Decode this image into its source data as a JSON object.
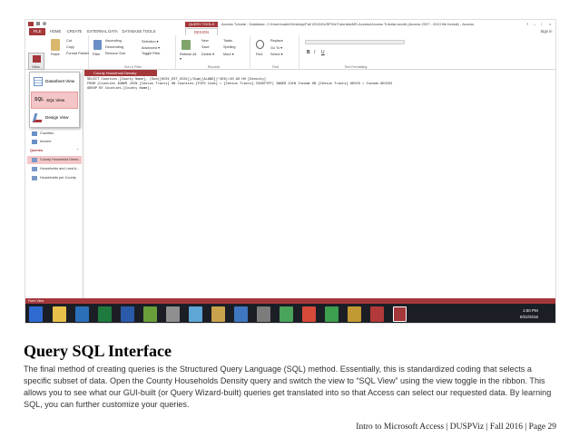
{
  "app": {
    "title_bar": "Access Tutorial : Database- C:\\Users\\ualm\\Desktop\\Fall 2016\\DUSPViz\\Tutorials\\MS-Access\\Access Tutorial.accdb (Access 2007 - 2013 file format) - Access",
    "context_tab": "QUERY TOOLS",
    "sign_in": "Sign in",
    "window_controls": [
      "?",
      "–",
      "□",
      "×"
    ]
  },
  "ribbon": {
    "tabs": [
      "FILE",
      "HOME",
      "CREATE",
      "EXTERNAL DATA",
      "DATABASE TOOLS",
      "DESIGN"
    ],
    "groups": {
      "clipboard": {
        "paste": "Paste",
        "cut": "Cut",
        "copy": "Copy",
        "format_painter": "Format Painter"
      },
      "sort_filter": {
        "label": "Sort & Filter",
        "filter": "Filter",
        "ascending": "Ascending",
        "descending": "Descending",
        "remove_sort": "Remove Sort",
        "selection": "Selection ▾",
        "advanced": "Advanced ▾",
        "toggle_filter": "Toggle Filter"
      },
      "records": {
        "label": "Records",
        "refresh_all": "Refresh All ▾",
        "new": "New",
        "save": "Save",
        "delete": "Delete ▾",
        "totals": "Totals",
        "spelling": "Spelling",
        "more": "More ▾"
      },
      "find": {
        "label": "Find",
        "find": "Find",
        "replace": "Replace",
        "go_to": "Go To ▾",
        "select": "Select ▾"
      },
      "text_formatting": {
        "label": "Text Formatting",
        "bold": "B",
        "italic": "I",
        "underline": "U"
      }
    }
  },
  "view_menu": {
    "view_button": "View",
    "items": [
      "Datasheet View",
      "SQL View",
      "Design View"
    ],
    "selected": "SQL View"
  },
  "nav_pane": {
    "tables": [
      "Counties",
      "Income"
    ],
    "queries_header": "Queries",
    "queries": [
      "County Household Densi...",
      "Households and Land A...",
      "Households per County"
    ],
    "selected_query": "County Household Densi..."
  },
  "document_tab": "County Household Density",
  "sql": [
    "SELECT Counties.[County Name], (Sum([HC01_EST_VC01])/Sum([ALAND])*1E6)/40 AS HH [Density]",
    "FROM (Counties INNER JOIN [Census Tracts] ON Counties.[FIPS Code] = [Census Tracts].COUNTYFP) INNER JOIN Income ON [Census Tracts].GEOID = Income.GEOID2",
    "GROUP BY Counties.[County Name];"
  ],
  "status_bar": "Form View",
  "taskbar": {
    "time": "1:50 PM",
    "date": "8/22/2016"
  },
  "page": {
    "heading": "Query SQL Interface",
    "paragraph": "The final method of creating queries is the Structured Query Language (SQL) method. Essentially, this is standardized coding that selects a specific subset of data. Open the County Households Density query and switch the view to “SQL View” using the view toggle in the ribbon. This allows you to see what our GUI-built (or Query Wizard-built) queries get translated into so that Access can select our requested data. By learning SQL, you can further customize your queries.",
    "footer": "Intro to Microsoft Access | DUSPViz | Fall 2016 | Page 29"
  },
  "colors": {
    "access_red": "#a4373a",
    "taskbar": "#1c1e26"
  }
}
